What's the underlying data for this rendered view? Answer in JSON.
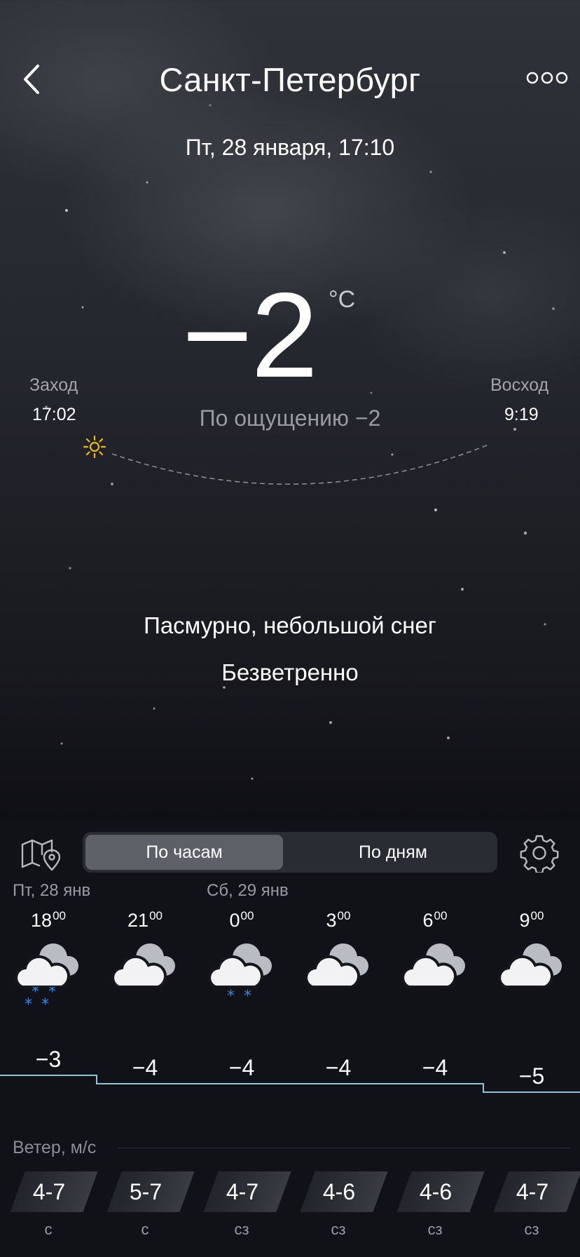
{
  "header": {
    "city": "Санкт-Петербург",
    "datetime": "Пт, 28 января, 17:10",
    "back_icon": "chevron-left-icon",
    "more_icon": "more-dots-icon"
  },
  "current": {
    "temp": "−2",
    "unit": "°C",
    "feels_like": "По ощущению −2",
    "condition": "Пасмурно, небольшой снег",
    "wind": "Безветренно"
  },
  "sun": {
    "sunset_label": "Заход",
    "sunset_time": "17:02",
    "sunrise_label": "Восход",
    "sunrise_time": "9:19",
    "icon": "sun-icon",
    "icon_color": "#f2b90c"
  },
  "forecast": {
    "map_icon": "map-icon",
    "settings_icon": "gear-icon",
    "tab_hourly": "По часам",
    "tab_daily": "По дням",
    "active_tab": "По часам",
    "day1": "Пт, 28 янв",
    "day2": "Сб, 29 янв",
    "wind_title": "Ветер, м/с",
    "line_color": "#8fc4dc",
    "snow_color": "#2f86e6",
    "hours": [
      {
        "hour": "18",
        "min": "00",
        "icon": "cloud-snow-icon",
        "temp": "−3",
        "wind": "4-7",
        "dir": "с"
      },
      {
        "hour": "21",
        "min": "00",
        "icon": "cloud-icon",
        "temp": "−4",
        "wind": "5-7",
        "dir": "с"
      },
      {
        "hour": "0",
        "min": "00",
        "icon": "cloud-light-snow-icon",
        "temp": "−4",
        "wind": "4-7",
        "dir": "сз"
      },
      {
        "hour": "3",
        "min": "00",
        "icon": "cloud-icon",
        "temp": "−4",
        "wind": "4-6",
        "dir": "сз"
      },
      {
        "hour": "6",
        "min": "00",
        "icon": "cloud-icon",
        "temp": "−4",
        "wind": "4-6",
        "dir": "сз"
      },
      {
        "hour": "9",
        "min": "00",
        "icon": "cloud-icon",
        "temp": "−5",
        "wind": "4-7",
        "dir": "сз"
      }
    ]
  }
}
